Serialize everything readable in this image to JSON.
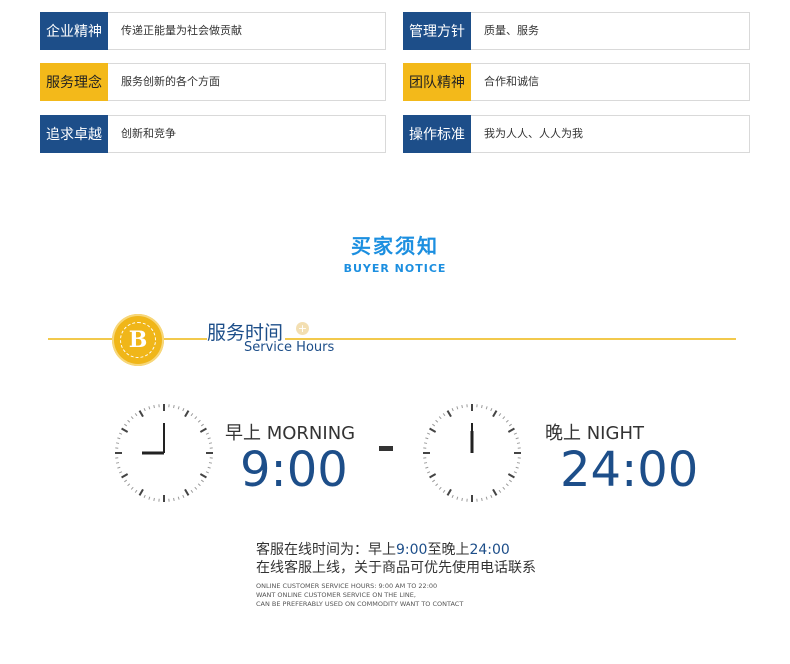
{
  "cards": [
    {
      "tag": "企业精神",
      "desc": "传递正能量为社会做贡献",
      "style": "blue"
    },
    {
      "tag": "管理方针",
      "desc": "质量、服务",
      "style": "blue"
    },
    {
      "tag": "服务理念",
      "desc": "服务创新的各个方面",
      "style": "gold"
    },
    {
      "tag": "团队精神",
      "desc": "合作和诚信",
      "style": "gold"
    },
    {
      "tag": "追求卓越",
      "desc": "创新和竞争",
      "style": "blue"
    },
    {
      "tag": "操作标准",
      "desc": "我为人人、人人为我",
      "style": "blue"
    }
  ],
  "notice": {
    "title": "买家须知",
    "subtitle": "BUYER NOTICE"
  },
  "hours": {
    "badge_letter": "B",
    "title": "服务时间",
    "subtitle": "Service Hours",
    "icons": {
      "badge": "coin-badge-icon",
      "plus": "plus-icon",
      "clock": "clock-icon"
    },
    "morning": {
      "label": "早上 MORNING",
      "time": "9:00",
      "hour": 9,
      "minute": 0
    },
    "night": {
      "label": "晚上 NIGHT",
      "time": "24:00",
      "hour": 12,
      "minute": 0
    },
    "line1_prefix": "客服在线时间为：早上",
    "line1_t1": "9:00",
    "line1_mid": "至晚上",
    "line1_t2": "24:00",
    "line2": "在线客服上线，关于商品可优先使用电话联系",
    "en1": "ONLINE CUSTOMER SERVICE HOURS: 9:00 AM TO 22:00",
    "en2": "WANT ONLINE CUSTOMER SERVICE ON THE LINE,",
    "en3": "CAN BE PREFERABLY USED ON COMMODITY WANT TO CONTACT"
  },
  "colors": {
    "blue": "#1d4e89",
    "gold": "#f3b91a",
    "accent": "#1c8fe0",
    "line": "#f2c94c"
  }
}
